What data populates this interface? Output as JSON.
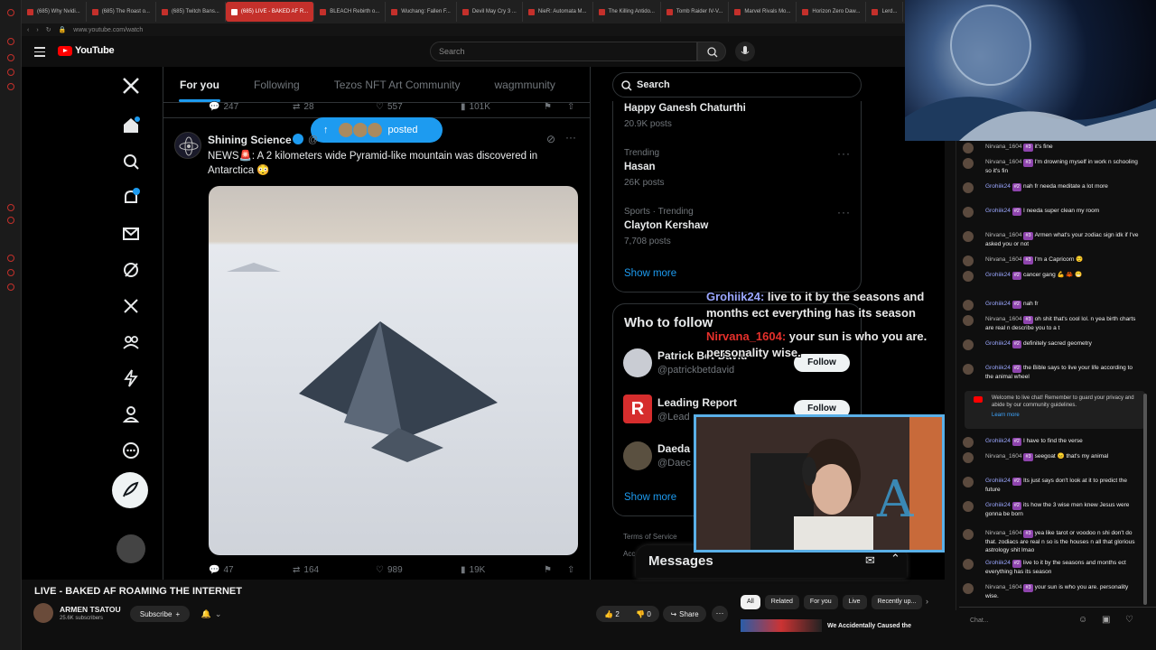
{
  "browser": {
    "tabs": [
      {
        "label": "(685) Why Nvidi..."
      },
      {
        "label": "(685) The Roast o..."
      },
      {
        "label": "(685) Twitch Bans..."
      },
      {
        "label": "(685) LIVE - BAKED AF R..."
      },
      {
        "label": "BLEACH Rebirth o..."
      },
      {
        "label": "Wuchang: Fallen F..."
      },
      {
        "label": "Devil May Cry 3 ..."
      },
      {
        "label": "NieR: Automata M..."
      },
      {
        "label": "The Killing Antido..."
      },
      {
        "label": "Tomb Raider IV-V..."
      },
      {
        "label": "Marvel Rivals Mo..."
      },
      {
        "label": "Horizon Zero Daw..."
      },
      {
        "label": "Lerd..."
      }
    ],
    "url": "www.youtube.com/watch"
  },
  "youtube": {
    "logo_text": "YouTube",
    "search_placeholder": "Search",
    "video_title": "LIVE - BAKED AF ROAMING THE INTERNET",
    "channel_name": "ARMEN TSATOU",
    "channel_subs": "25.6K subscribers",
    "subscribe_label": "Subscribe",
    "likes": "2",
    "dislikes": "0",
    "share_label": "Share",
    "chips": [
      "All",
      "Related",
      "For you",
      "Live",
      "Recently up..."
    ],
    "rec_title": "We Accidentally Caused the"
  },
  "x": {
    "tabs": [
      "For you",
      "Following",
      "Tezos NFT Art Community",
      "wagmmunity"
    ],
    "prev_stats": {
      "replies": "247",
      "reposts": "28",
      "likes": "557",
      "views": "101K"
    },
    "posted_label": "posted",
    "tweet": {
      "author": "Shining Science",
      "handle": "@",
      "text": "NEWS🚨: A 2 kilometers wide Pyramid-like mountain was discovered in Antarctica 😳",
      "stats": {
        "replies": "47",
        "reposts": "164",
        "likes": "989",
        "views": "19K"
      }
    },
    "search_label": "Search",
    "trends": [
      {
        "meta": "",
        "title": "Happy Ganesh Chaturthi",
        "posts": "20.9K posts"
      },
      {
        "meta": "Trending",
        "title": "Hasan",
        "posts": "26K posts"
      },
      {
        "meta": "Sports · Trending",
        "title": "Clayton Kershaw",
        "posts": "7,708 posts"
      }
    ],
    "show_more": "Show more",
    "who_to_follow_title": "Who to follow",
    "who_to_follow": [
      {
        "name": "Patrick Bet-David",
        "handle": "@patrickbetdavid",
        "button": "Follow"
      },
      {
        "name": "Leading Report",
        "handle": "@Lead",
        "button": "Follow"
      },
      {
        "name": "Daeda",
        "handle": "@Daec",
        "button": ""
      }
    ],
    "show_more_2": "Show more",
    "footer_terms": "Terms of Service",
    "footer_acc": "Acc",
    "messages_label": "Messages"
  },
  "overlay_chat": [
    {
      "author": "Grohiik24:",
      "text": "live to it by the seasons and months ect everything has its season",
      "color": "#9ba7ff"
    },
    {
      "author": "Nirvana_1604:",
      "text": "your sun is who you are. personality wise.",
      "color": "#e5302b"
    }
  ],
  "live_chat": {
    "messages": [
      {
        "author": "Nirvana_1604",
        "rank": "#3",
        "text": "it's fine",
        "mod": true
      },
      {
        "author": "Nirvana_1604",
        "rank": "#3",
        "text": "I'm drowning myself in work n schooling so it's fin",
        "mod": true
      },
      {
        "author": "Grohiik24",
        "rank": "#2",
        "text": "nah fr needa meditate a lot more",
        "mod": false
      },
      {
        "author": "Grohiik24",
        "rank": "#2",
        "text": "I needa super clean my room",
        "mod": false
      },
      {
        "author": "Nirvana_1604",
        "rank": "#3",
        "text": "Armen what's your zodiac sign idk if I've asked you or not",
        "mod": true
      },
      {
        "author": "Nirvana_1604",
        "rank": "#3",
        "text": "I'm a Capricorn 😌",
        "mod": true
      },
      {
        "author": "Grohiik24",
        "rank": "#2",
        "text": "cancer gang 💪 🦀 😁",
        "mod": false
      },
      {
        "author": "Grohiik24",
        "rank": "#2",
        "text": "nah fr",
        "mod": false
      },
      {
        "author": "Nirvana_1604",
        "rank": "#3",
        "text": "oh shit that's cool lol. n yea birth charts are real n describe you to a t",
        "mod": true
      },
      {
        "author": "Grohiik24",
        "rank": "#2",
        "text": "definitely sacred geometry",
        "mod": false
      },
      {
        "author": "Grohiik24",
        "rank": "#2",
        "text": "the Bible says to live your life according to the animal wheel",
        "mod": false
      }
    ],
    "banner_text": "Welcome to live chat! Remember to guard your privacy and abide by our community guidelines.",
    "banner_link": "Learn more",
    "messages_after": [
      {
        "author": "Grohiik24",
        "rank": "#2",
        "text": "I have to find the verse",
        "mod": false
      },
      {
        "author": "Nirvana_1604",
        "rank": "#3",
        "text": "seegoat 😑 that's my animal",
        "mod": true
      },
      {
        "author": "Grohiik24",
        "rank": "#2",
        "text": "Its just says don't look at it to predict the future",
        "mod": false
      },
      {
        "author": "Grohiik24",
        "rank": "#2",
        "text": "its how the 3 wise men knew Jesus were gonna be born",
        "mod": false
      },
      {
        "author": "Nirvana_1604",
        "rank": "#3",
        "text": "yea like tarot or voodoo n shi don't do that. zodiacs are real n so is the houses n all that glorious astrology shit lmao",
        "mod": true
      },
      {
        "author": "Grohiik24",
        "rank": "#2",
        "text": "live to it by the seasons and months ect everything has its season",
        "mod": false
      },
      {
        "author": "Nirvana_1604",
        "rank": "#3",
        "text": "your sun is who you are. personality wise.",
        "mod": true
      }
    ],
    "input_placeholder": "Chat..."
  }
}
